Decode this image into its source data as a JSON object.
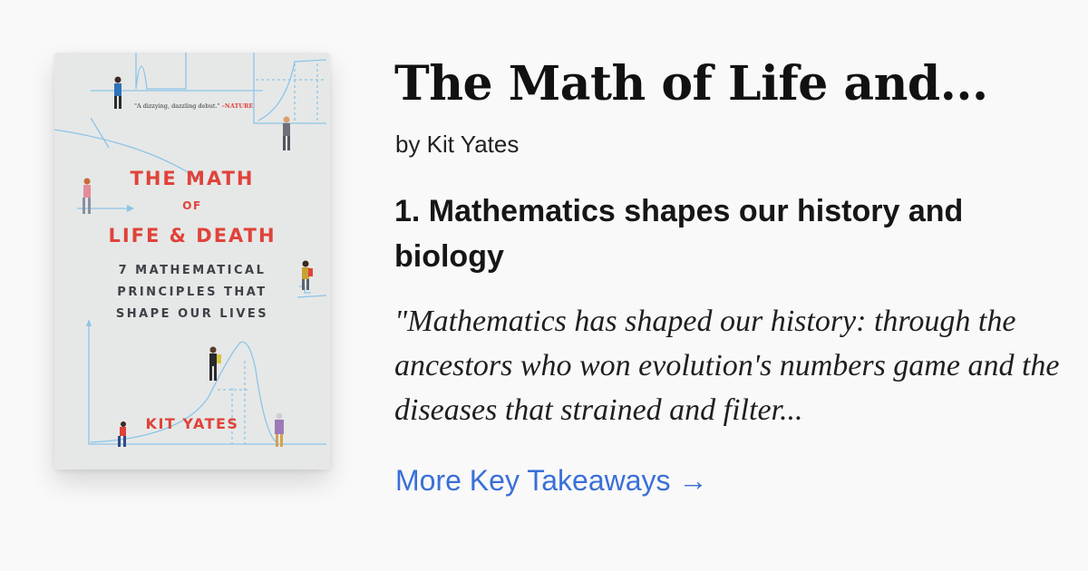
{
  "book": {
    "cover": {
      "blurb_quote": "\"A dizzying, dazzling debut.\"",
      "blurb_source": "–NATURE",
      "title_line1": "THE MATH",
      "title_line2": "OF",
      "title_line3": "LIFE & DEATH",
      "subtitle_line1": "7 MATHEMATICAL",
      "subtitle_line2": "PRINCIPLES THAT",
      "subtitle_line3": "SHAPE OUR LIVES",
      "author": "KIT YATES"
    },
    "title": "The Math of Life and...",
    "author_line": "by Kit Yates"
  },
  "takeaway": {
    "heading": "1. Mathematics shapes our history and biology",
    "quote": "\"Mathematics has shaped our history: through the ancestors who won evolution's numbers game and the diseases that strained and filter..."
  },
  "link": {
    "label": "More Key Takeaways →"
  },
  "colors": {
    "accent_red": "#e0423a",
    "link_blue": "#3a6fd8",
    "cover_bg": "#e6e8e7",
    "line_blue": "#8cc4e8"
  }
}
